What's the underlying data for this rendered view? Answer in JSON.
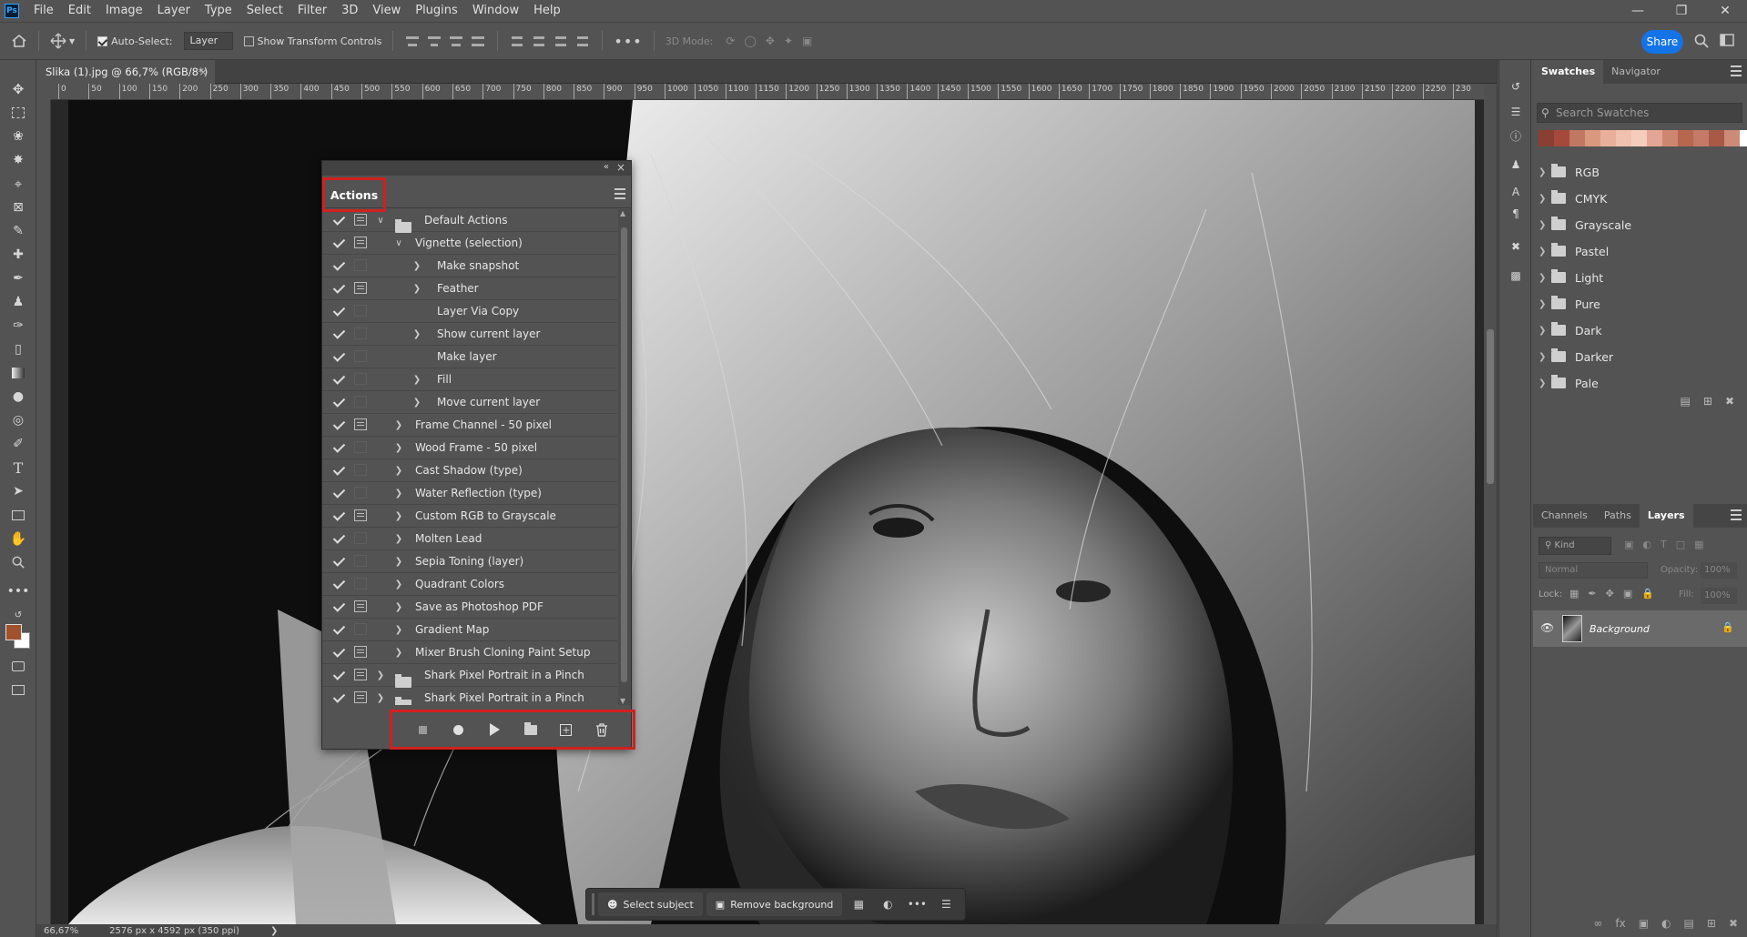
{
  "app": {
    "logo_text": "Ps"
  },
  "menu": [
    "File",
    "Edit",
    "Image",
    "Layer",
    "Type",
    "Select",
    "Filter",
    "3D",
    "View",
    "Plugins",
    "Window",
    "Help"
  ],
  "window_controls": [
    "minimize",
    "restore",
    "close"
  ],
  "options_bar": {
    "auto_select_label": "Auto-Select:",
    "auto_select_target": "Layer",
    "transform_controls_label": "Show Transform Controls",
    "mode_3d_label": "3D Mode:",
    "share_label": "Share"
  },
  "document": {
    "tab_title": "Slika (1).jpg @ 66,7% (RGB/8*)",
    "zoom": "66,67%",
    "info": "2576 px x 4592 px (350 ppi)"
  },
  "ruler_ticks": [
    "0",
    "50",
    "100",
    "150",
    "200",
    "250",
    "300",
    "350",
    "400",
    "450",
    "500",
    "550",
    "600",
    "650",
    "700",
    "750",
    "800",
    "850",
    "900",
    "950",
    "1000",
    "1050",
    "1100",
    "1150",
    "1200",
    "1250",
    "1300",
    "1350",
    "1400",
    "1450",
    "1500",
    "1550",
    "1600",
    "1650",
    "1700",
    "1750",
    "1800",
    "1850",
    "1900",
    "1950",
    "2000",
    "2050",
    "2100",
    "2150",
    "2200",
    "2250",
    "230"
  ],
  "actions_panel": {
    "title": "Actions",
    "rows": [
      {
        "label": "Default Actions",
        "level": 0,
        "chev": "down",
        "dialog": true,
        "folder": true
      },
      {
        "label": "Vignette (selection)",
        "level": 1,
        "chev": "down",
        "dialog": true,
        "folder": false
      },
      {
        "label": "Make snapshot",
        "level": 2,
        "chev": "right",
        "dialog": false,
        "folder": false
      },
      {
        "label": "Feather",
        "level": 2,
        "chev": "right",
        "dialog": true,
        "folder": false
      },
      {
        "label": "Layer Via Copy",
        "level": 2,
        "chev": "none",
        "dialog": false,
        "folder": false
      },
      {
        "label": "Show current layer",
        "level": 2,
        "chev": "right",
        "dialog": false,
        "folder": false
      },
      {
        "label": "Make layer",
        "level": 2,
        "chev": "none",
        "dialog": false,
        "folder": false
      },
      {
        "label": "Fill",
        "level": 2,
        "chev": "right",
        "dialog": false,
        "folder": false
      },
      {
        "label": "Move current layer",
        "level": 2,
        "chev": "right",
        "dialog": false,
        "folder": false
      },
      {
        "label": "Frame Channel - 50 pixel",
        "level": 1,
        "chev": "right",
        "dialog": true,
        "folder": false
      },
      {
        "label": "Wood Frame - 50 pixel",
        "level": 1,
        "chev": "right",
        "dialog": false,
        "folder": false
      },
      {
        "label": "Cast Shadow (type)",
        "level": 1,
        "chev": "right",
        "dialog": false,
        "folder": false
      },
      {
        "label": "Water Reflection (type)",
        "level": 1,
        "chev": "right",
        "dialog": false,
        "folder": false
      },
      {
        "label": "Custom RGB to Grayscale",
        "level": 1,
        "chev": "right",
        "dialog": true,
        "folder": false
      },
      {
        "label": "Molten Lead",
        "level": 1,
        "chev": "right",
        "dialog": false,
        "folder": false
      },
      {
        "label": "Sepia Toning (layer)",
        "level": 1,
        "chev": "right",
        "dialog": false,
        "folder": false
      },
      {
        "label": "Quadrant Colors",
        "level": 1,
        "chev": "right",
        "dialog": false,
        "folder": false
      },
      {
        "label": "Save as Photoshop PDF",
        "level": 1,
        "chev": "right",
        "dialog": true,
        "folder": false
      },
      {
        "label": "Gradient Map",
        "level": 1,
        "chev": "right",
        "dialog": false,
        "folder": false
      },
      {
        "label": "Mixer Brush Cloning Paint Setup",
        "level": 1,
        "chev": "right",
        "dialog": true,
        "folder": false
      },
      {
        "label": "Shark Pixel Portrait in a Pinch",
        "level": 0,
        "chev": "right",
        "dialog": true,
        "folder": true
      },
      {
        "label": "Shark Pixel Portrait in a Pinch",
        "level": 0,
        "chev": "right",
        "dialog": true,
        "folder": true
      }
    ],
    "footer_buttons": [
      "stop",
      "record",
      "play",
      "new-set",
      "new-action",
      "delete"
    ]
  },
  "swatches_panel": {
    "tabs": [
      "Swatches",
      "Navigator"
    ],
    "search_placeholder": "Search Swatches",
    "recent_colors": [
      "#8a3f33",
      "#a4493c",
      "#c17863",
      "#d9997e",
      "#e8b09a",
      "#f0c1ae",
      "#f4cdbd",
      "#e3a694",
      "#cf8671",
      "#b7664f",
      "#c47a66",
      "#a85a46",
      "#cd8a76",
      "#ffffff"
    ],
    "folders": [
      "RGB",
      "CMYK",
      "Grayscale",
      "Pastel",
      "Light",
      "Pure",
      "Dark",
      "Darker",
      "Pale"
    ]
  },
  "layers_panel": {
    "tabs": [
      "Channels",
      "Paths",
      "Layers"
    ],
    "kind_label": "Kind",
    "blend_mode": "Normal",
    "opacity_label": "Opacity:",
    "opacity_value": "100%",
    "lock_label": "Lock:",
    "fill_label": "Fill:",
    "fill_value": "100%",
    "layer_name": "Background"
  },
  "context_bar": {
    "select_subject": "Select subject",
    "remove_background": "Remove background"
  },
  "colors": {
    "foreground": "#a0522d",
    "background": "#ffffff",
    "highlight": "#d1201f",
    "accent": "#1473e6"
  }
}
